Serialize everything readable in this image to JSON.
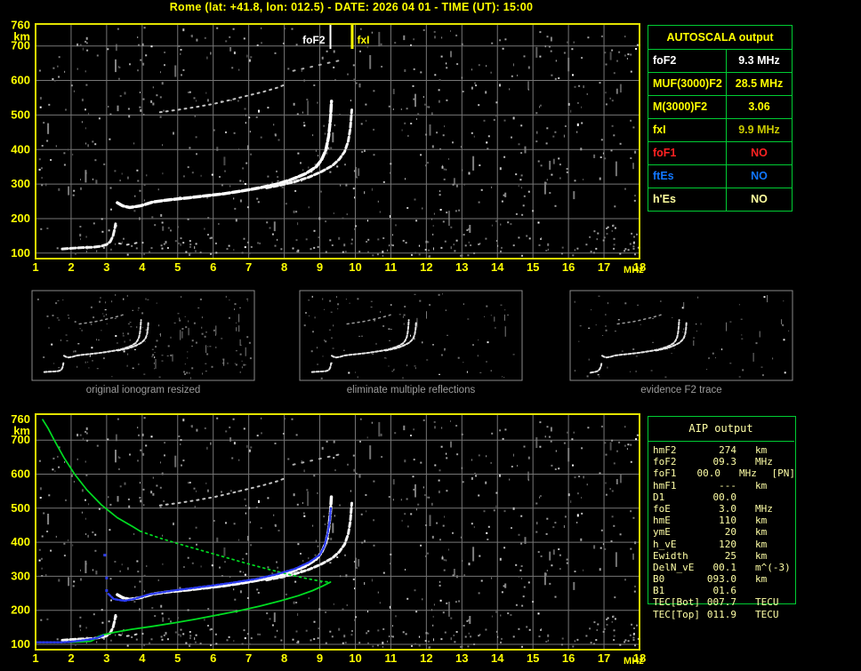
{
  "title": "Rome (lat: +41.8, lon: 012.5) - DATE: 2026 04 01 - TIME (UT): 15:00",
  "colors": {
    "background": "#000000",
    "axis_yellow": "#ffff00",
    "border_yellow": "#e3e300",
    "grid_gray": "#767676",
    "table_green": "#00cc33",
    "trace_white": "#ffffff",
    "profile_green": "#00dd22",
    "restored_blue": "#2b3bf0",
    "caption_gray": "#9c9c9c",
    "aip_text": "#ffffa6",
    "status_red": "#ff2222",
    "status_blue": "#1177ff",
    "pale_yellow": "#ffff9e",
    "fxi_value_yellow": "#c9c900"
  },
  "autoscala_table": {
    "title": "AUTOSCALA output",
    "rows": [
      {
        "label": "foF2",
        "value": "9.3 MHz",
        "label_color": "#ffffff",
        "value_color": "#ffffff"
      },
      {
        "label": "MUF(3000)F2",
        "value": "28.5 MHz",
        "label_color": "#ffff00",
        "value_color": "#ffff00"
      },
      {
        "label": "M(3000)F2",
        "value": "3.06",
        "label_color": "#ffff00",
        "value_color": "#ffff00"
      },
      {
        "label": "fxI",
        "value": "9.9 MHz",
        "label_color": "#ffff00",
        "value_color": "#c9c900"
      },
      {
        "label": "foF1",
        "value": "NO",
        "label_color": "#ff2222",
        "value_color": "#ff2222"
      },
      {
        "label": "ftEs",
        "value": "NO",
        "label_color": "#1177ff",
        "value_color": "#1177ff"
      },
      {
        "label": "h'Es",
        "value": "NO",
        "label_color": "#ffff9e",
        "value_color": "#ffff9e"
      }
    ]
  },
  "aip_table": {
    "title": "AIP output",
    "rows": [
      {
        "label": "hmF2",
        "value": "274",
        "unit": "km",
        "extra": ""
      },
      {
        "label": "foF2",
        "value": "09.3",
        "unit": "MHz",
        "extra": ""
      },
      {
        "label": "foF1",
        "value": "00.0",
        "unit": "MHz",
        "extra": "[PN]"
      },
      {
        "label": "hmF1",
        "value": "---",
        "unit": "km",
        "extra": ""
      },
      {
        "label": "D1",
        "value": "00.0",
        "unit": "",
        "extra": ""
      },
      {
        "label": "foE",
        "value": "3.0",
        "unit": "MHz",
        "extra": ""
      },
      {
        "label": "hmE",
        "value": "110",
        "unit": "km",
        "extra": ""
      },
      {
        "label": "ymE",
        "value": "20",
        "unit": "km",
        "extra": ""
      },
      {
        "label": "h_vE",
        "value": "120",
        "unit": "km",
        "extra": ""
      },
      {
        "label": "Ewidth",
        "value": "25",
        "unit": "km",
        "extra": ""
      },
      {
        "label": "DelN_vE",
        "value": "00.1",
        "unit": "m^(-3)",
        "extra": ""
      },
      {
        "label": "B0",
        "value": "093.0",
        "unit": "km",
        "extra": ""
      },
      {
        "label": "B1",
        "value": "01.6",
        "unit": "",
        "extra": ""
      },
      {
        "label": "TEC[Bot]",
        "value": "007.7",
        "unit": "TECU",
        "extra": ""
      },
      {
        "label": "TEC[Top]",
        "value": "011.9",
        "unit": "TECU",
        "extra": ""
      }
    ]
  },
  "panels": [
    {
      "caption": "original ionogram resized",
      "traces": [
        "E_region",
        "F2_ordinary",
        "F2_extraordinary",
        "multiple_reflection"
      ]
    },
    {
      "caption": "eliminate multiple reflections",
      "traces": [
        "E_region",
        "F2_ordinary",
        "F2_extraordinary",
        "multiple_reflection"
      ]
    },
    {
      "caption": "evidence F2 trace",
      "traces": [
        "E_cusp",
        "F2_ordinary",
        "F2_extraordinary",
        "multiple_reflection"
      ]
    }
  ],
  "chart_data": {
    "type": "scatter",
    "x_axis": {
      "label": "MHz",
      "min": 1,
      "max": 18,
      "ticks": [
        1,
        2,
        3,
        4,
        5,
        6,
        7,
        8,
        9,
        10,
        11,
        12,
        13,
        14,
        15,
        16,
        17,
        18
      ]
    },
    "y_axis": {
      "label": "km",
      "min": 100,
      "max": 760,
      "ticks": [
        100,
        200,
        300,
        400,
        500,
        600,
        700,
        760
      ]
    },
    "grid": true,
    "markers": [
      {
        "name": "foF2",
        "label": "foF2",
        "freq_mhz": 9.3,
        "color": "#ffffff"
      },
      {
        "name": "fxI",
        "label": "fxI",
        "freq_mhz": 9.9,
        "color": "#ffff00"
      }
    ],
    "traces": {
      "E_region": {
        "color": "#f2f2f2",
        "points": [
          [
            1.75,
            112
          ],
          [
            2.0,
            114
          ],
          [
            2.3,
            116
          ],
          [
            2.6,
            117
          ],
          [
            2.85,
            120
          ],
          [
            3.0,
            125
          ],
          [
            3.1,
            133
          ],
          [
            3.18,
            150
          ],
          [
            3.23,
            172
          ],
          [
            3.25,
            185
          ]
        ]
      },
      "E_region_scatter": {
        "color": "#cfcfcf",
        "points": [
          [
            3.35,
            128
          ],
          [
            3.55,
            124
          ],
          [
            3.75,
            127
          ],
          [
            3.95,
            133
          ]
        ]
      },
      "E_cusp": {
        "color": "#f2f2f2",
        "points": [
          [
            2.4,
            108
          ],
          [
            2.7,
            112
          ],
          [
            2.95,
            120
          ],
          [
            3.1,
            135
          ],
          [
            3.2,
            158
          ],
          [
            3.24,
            180
          ]
        ]
      },
      "F2_ordinary": {
        "color": "#ffffff",
        "points": [
          [
            3.3,
            246
          ],
          [
            3.45,
            237
          ],
          [
            3.65,
            232
          ],
          [
            3.95,
            237
          ],
          [
            4.3,
            248
          ],
          [
            4.8,
            255
          ],
          [
            5.3,
            260
          ],
          [
            5.8,
            266
          ],
          [
            6.3,
            272
          ],
          [
            6.8,
            280
          ],
          [
            7.3,
            289
          ],
          [
            7.8,
            300
          ],
          [
            8.2,
            313
          ],
          [
            8.6,
            330
          ],
          [
            8.9,
            350
          ],
          [
            9.05,
            370
          ],
          [
            9.17,
            398
          ],
          [
            9.25,
            438
          ],
          [
            9.3,
            488
          ],
          [
            9.33,
            540
          ]
        ]
      },
      "F2_extraordinary": {
        "color": "#f5f5f5",
        "points": [
          [
            7.5,
            289
          ],
          [
            7.9,
            297
          ],
          [
            8.3,
            307
          ],
          [
            8.7,
            320
          ],
          [
            9.05,
            336
          ],
          [
            9.35,
            353
          ],
          [
            9.55,
            372
          ],
          [
            9.7,
            394
          ],
          [
            9.8,
            424
          ],
          [
            9.86,
            462
          ],
          [
            9.9,
            515
          ]
        ]
      },
      "multiple_reflection": {
        "color": "#c4c4c4",
        "points": [
          [
            4.5,
            508
          ],
          [
            5.0,
            515
          ],
          [
            5.5,
            523
          ],
          [
            6.0,
            532
          ],
          [
            6.5,
            544
          ],
          [
            7.0,
            557
          ],
          [
            7.4,
            567
          ],
          [
            7.8,
            579
          ],
          [
            8.05,
            589
          ]
        ]
      },
      "multiple_reflection_2": {
        "color": "#b0b0b0",
        "points": [
          [
            8.25,
            628
          ],
          [
            8.7,
            638
          ],
          [
            9.2,
            650
          ],
          [
            9.7,
            661
          ]
        ]
      },
      "profile_topside_solid": {
        "color": "#00dd22",
        "points": [
          [
            1.2,
            760
          ],
          [
            1.35,
            735
          ],
          [
            1.55,
            695
          ],
          [
            1.8,
            648
          ],
          [
            2.1,
            600
          ],
          [
            2.45,
            553
          ],
          [
            2.85,
            510
          ],
          [
            3.3,
            472
          ],
          [
            3.75,
            445
          ],
          [
            3.95,
            432
          ]
        ]
      },
      "profile_topside_dotted": {
        "color": "#00dd22",
        "points": [
          [
            3.95,
            432
          ],
          [
            4.5,
            412
          ],
          [
            5.1,
            393
          ],
          [
            5.7,
            375
          ],
          [
            6.3,
            357
          ],
          [
            6.9,
            339
          ],
          [
            7.5,
            322
          ],
          [
            8.1,
            306
          ],
          [
            8.6,
            294
          ],
          [
            9.0,
            286
          ],
          [
            9.25,
            283
          ]
        ]
      },
      "profile_bottomside": {
        "color": "#00dd22",
        "points": [
          [
            9.3,
            283
          ],
          [
            9.1,
            272
          ],
          [
            8.8,
            258
          ],
          [
            8.4,
            243
          ],
          [
            7.9,
            228
          ],
          [
            7.3,
            212
          ],
          [
            6.7,
            198
          ],
          [
            6.1,
            186
          ],
          [
            5.5,
            174
          ],
          [
            4.9,
            163
          ],
          [
            4.3,
            153
          ],
          [
            3.7,
            144
          ],
          [
            3.2,
            135
          ],
          [
            2.9,
            128
          ],
          [
            2.75,
            122
          ],
          [
            2.65,
            114
          ],
          [
            2.55,
            109
          ],
          [
            2.2,
            107
          ],
          [
            1.95,
            106
          ]
        ]
      },
      "restored_E": {
        "color": "#2b3bf0",
        "points": [
          [
            1.0,
            106
          ],
          [
            1.2,
            106
          ],
          [
            1.45,
            106
          ],
          [
            1.7,
            106
          ],
          [
            1.95,
            107
          ],
          [
            2.2,
            110
          ],
          [
            2.5,
            114
          ],
          [
            2.75,
            119
          ],
          [
            2.9,
            126
          ]
        ]
      },
      "restored_F": {
        "color": "#2b3bf0",
        "points": [
          [
            3.05,
            248
          ],
          [
            3.2,
            233
          ],
          [
            3.5,
            228
          ],
          [
            3.8,
            234
          ],
          [
            4.2,
            247
          ],
          [
            4.8,
            257
          ],
          [
            5.4,
            265
          ],
          [
            6.0,
            273
          ],
          [
            6.6,
            282
          ],
          [
            7.2,
            292
          ],
          [
            7.8,
            306
          ],
          [
            8.3,
            322
          ],
          [
            8.7,
            341
          ],
          [
            9.0,
            363
          ],
          [
            9.13,
            388
          ],
          [
            9.22,
            425
          ],
          [
            9.28,
            462
          ],
          [
            9.31,
            500
          ]
        ]
      },
      "restored_points": {
        "color": "#2b3bf0",
        "points": [
          [
            2.95,
            362
          ],
          [
            3.0,
            295
          ],
          [
            3.0,
            258
          ]
        ]
      }
    },
    "top_chart": {
      "name": "autoscaled ionogram",
      "traces": [
        "E_region",
        "E_region_scatter",
        "F2_ordinary",
        "F2_extraordinary",
        "multiple_reflection",
        "multiple_reflection_2"
      ]
    },
    "bottom_chart": {
      "name": "ionogram with restored trace and electron density profile",
      "traces": [
        "E_region",
        "E_region_scatter",
        "F2_ordinary",
        "F2_extraordinary",
        "multiple_reflection",
        "multiple_reflection_2",
        "profile_topside_solid",
        "profile_topside_dotted",
        "profile_bottomside",
        "restored_E",
        "restored_F"
      ]
    }
  }
}
